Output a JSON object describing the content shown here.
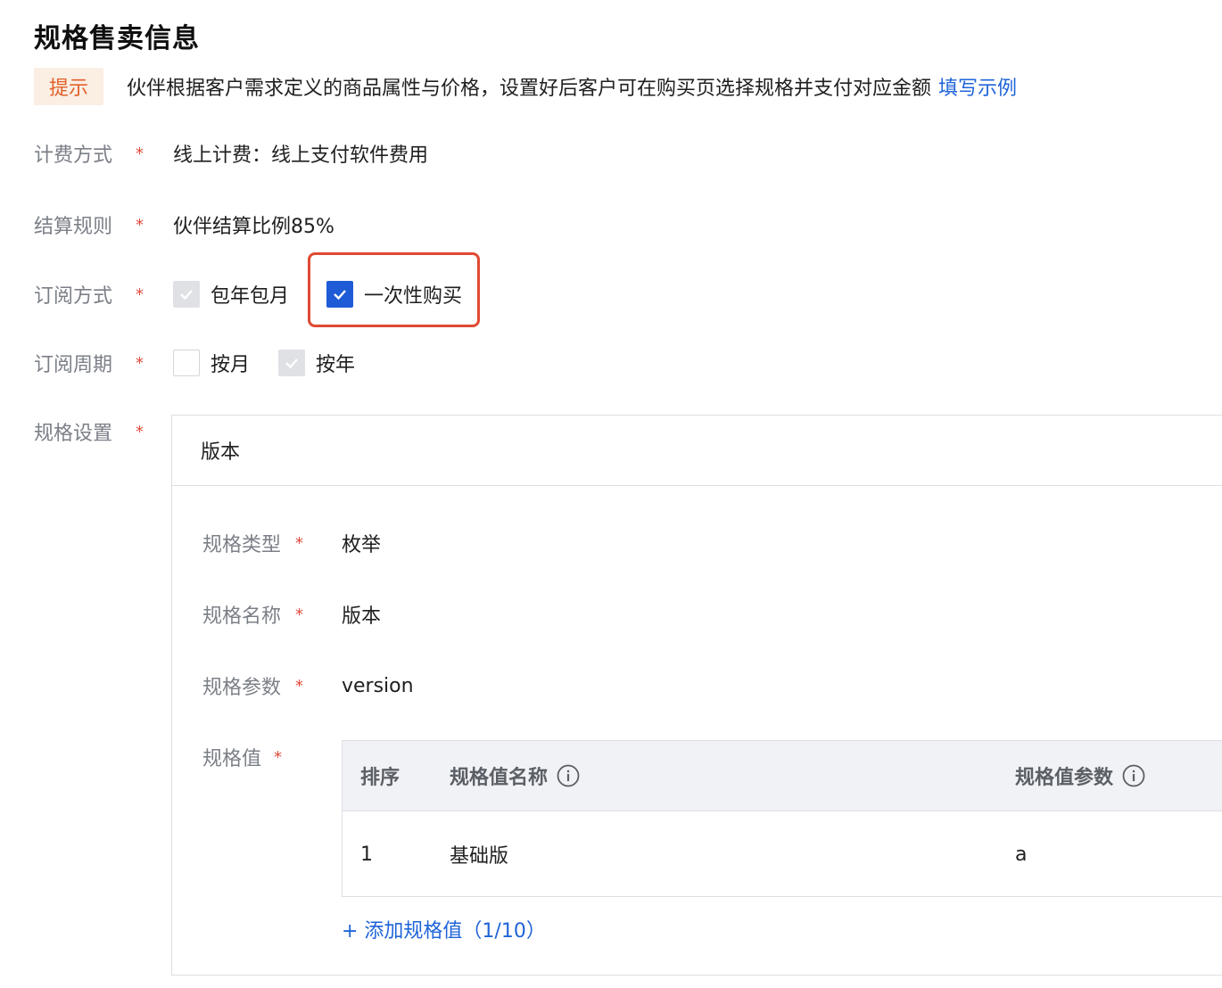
{
  "page": {
    "title": "规格售卖信息"
  },
  "hint": {
    "badge": "提示",
    "text": "伙伴根据客户需求定义的商品属性与价格，设置好后客户可在购买页选择规格并支付对应金额",
    "link": "填写示例"
  },
  "billing": {
    "label": "计费方式",
    "value": "线上计费：线上支付软件费用"
  },
  "settlement": {
    "label": "结算规则",
    "value": "伙伴结算比例85%"
  },
  "subscription": {
    "label": "订阅方式",
    "options": [
      {
        "label": "包年包月",
        "state": "checked-disabled"
      },
      {
        "label": "一次性购买",
        "state": "checked"
      }
    ]
  },
  "period": {
    "label": "订阅周期",
    "options": [
      {
        "label": "按月",
        "state": "unchecked"
      },
      {
        "label": "按年",
        "state": "checked-disabled"
      }
    ]
  },
  "spec": {
    "label": "规格设置",
    "header": "版本",
    "type": {
      "label": "规格类型",
      "value": "枚举"
    },
    "name": {
      "label": "规格名称",
      "value": "版本"
    },
    "param": {
      "label": "规格参数",
      "value": "version"
    },
    "values": {
      "label": "规格值",
      "columns": [
        "排序",
        "规格值名称",
        "规格值参数"
      ],
      "rows": [
        {
          "order": "1",
          "name": "基础版",
          "param": "a"
        }
      ],
      "add_label": "+ 添加规格值（1/10）"
    }
  },
  "required_mark": "*",
  "colors": {
    "accent": "#1f5bd6",
    "required": "#e14b3b",
    "highlight": "#e04a32"
  }
}
